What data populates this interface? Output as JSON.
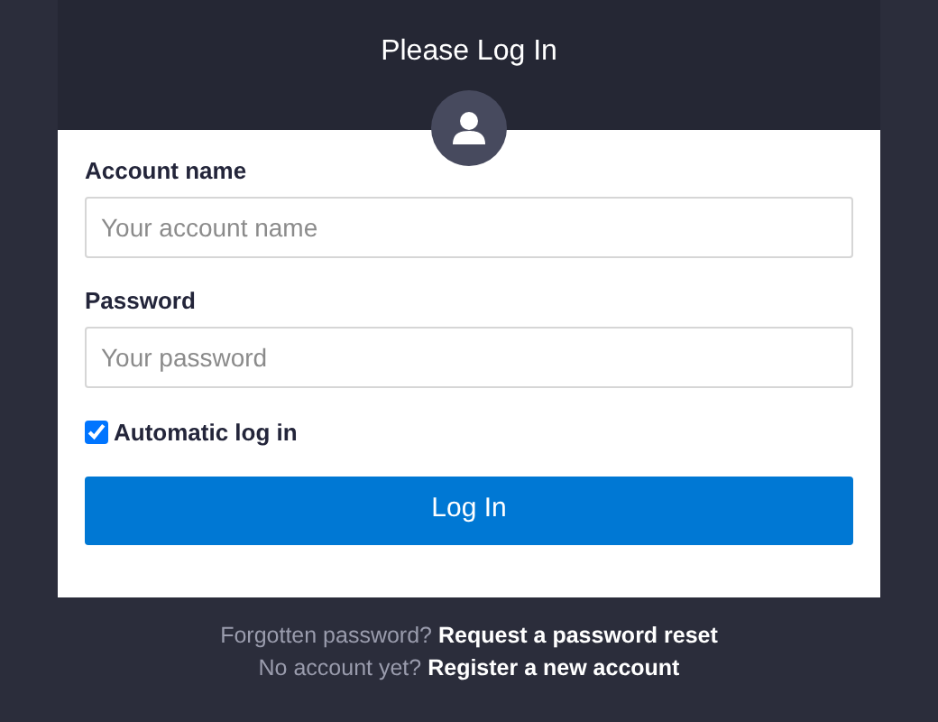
{
  "title": "Please Log In",
  "fields": [
    {
      "label": "Account name",
      "placeholder": "Your account name"
    },
    {
      "label": "Password",
      "placeholder": "Your password"
    }
  ],
  "remember": {
    "label": "Automatic log in",
    "checked": true
  },
  "submit": "Log In",
  "footer": [
    {
      "text": "Forgotten password?",
      "link": "Request a password reset"
    },
    {
      "text": "No account yet?",
      "link": "Register a new account"
    }
  ]
}
